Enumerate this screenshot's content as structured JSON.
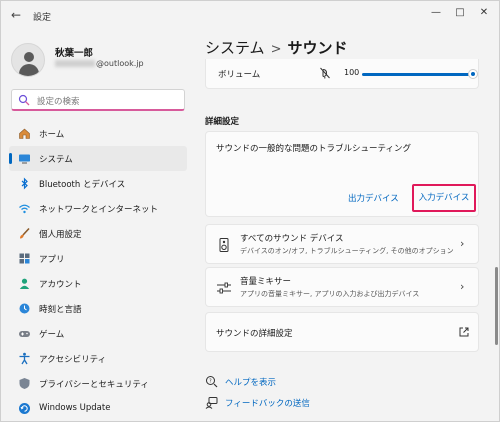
{
  "app": {
    "title": "設定"
  },
  "user": {
    "name": "秋葉一郎",
    "email_visible": "@outlook.jp"
  },
  "search": {
    "placeholder": "設定の検索"
  },
  "sidebar": {
    "items": [
      {
        "label": "ホーム",
        "icon": "home-icon"
      },
      {
        "label": "システム",
        "icon": "system-icon",
        "active": true
      },
      {
        "label": "Bluetooth とデバイス",
        "icon": "bluetooth-icon"
      },
      {
        "label": "ネットワークとインターネット",
        "icon": "wifi-icon"
      },
      {
        "label": "個人用設定",
        "icon": "brush-icon"
      },
      {
        "label": "アプリ",
        "icon": "apps-icon"
      },
      {
        "label": "アカウント",
        "icon": "account-icon"
      },
      {
        "label": "時刻と言語",
        "icon": "time-language-icon"
      },
      {
        "label": "ゲーム",
        "icon": "gamepad-icon"
      },
      {
        "label": "アクセシビリティ",
        "icon": "accessibility-icon"
      },
      {
        "label": "プライバシーとセキュリティ",
        "icon": "shield-icon"
      },
      {
        "label": "Windows Update",
        "icon": "update-icon"
      }
    ]
  },
  "breadcrumb": {
    "parent": "システム",
    "separator": ">",
    "current": "サウンド"
  },
  "volume": {
    "label": "ボリューム",
    "value": "100",
    "level_percent": 100
  },
  "advanced_section": {
    "title": "詳細設定"
  },
  "troubleshoot": {
    "title": "サウンドの一般的な問題のトラブルシューティング",
    "output_label": "出力デバイス",
    "input_label": "入力デバイス"
  },
  "all_devices": {
    "title": "すべてのサウンド デバイス",
    "subtitle": "デバイスのオン/オフ, トラブルシューティング, その他のオプション"
  },
  "mixer": {
    "title": "音量ミキサー",
    "subtitle": "アプリの音量ミキサー, アプリの入力および出力デバイス"
  },
  "advanced_sound": {
    "title": "サウンドの詳細設定"
  },
  "help": {
    "show_help": "ヘルプを表示",
    "feedback": "フィードバックの送信"
  },
  "colors": {
    "accent": "#0067c0",
    "highlight_border": "#e0195a"
  }
}
